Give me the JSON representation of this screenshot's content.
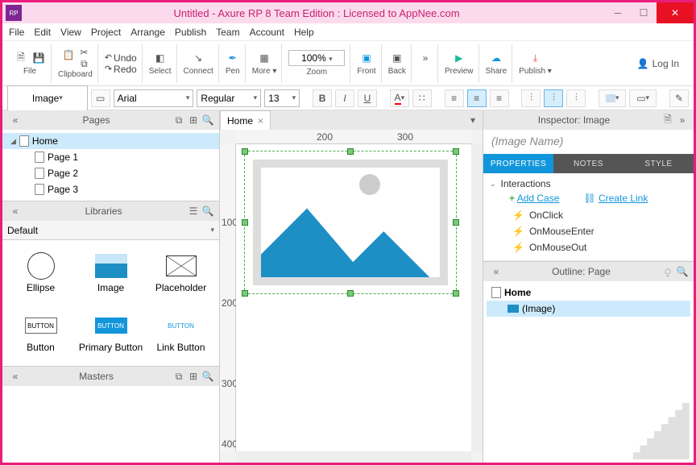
{
  "title": "Untitled - Axure RP 8 Team Edition : Licensed to AppNee.com",
  "menu": [
    "File",
    "Edit",
    "View",
    "Project",
    "Arrange",
    "Publish",
    "Team",
    "Account",
    "Help"
  ],
  "toolbar": {
    "file": "File",
    "clipboard": "Clipboard",
    "undo": "Undo",
    "redo": "Redo",
    "select": "Select",
    "connect": "Connect",
    "pen": "Pen",
    "more": "More ▾",
    "zoom_value": "100%",
    "zoom": "Zoom",
    "front": "Front",
    "back": "Back",
    "preview": "Preview",
    "share": "Share",
    "publish": "Publish ▾",
    "login": "Log In"
  },
  "format": {
    "shape": "Image",
    "font": "Arial",
    "style": "Regular",
    "size": "13"
  },
  "pages_panel": {
    "title": "Pages"
  },
  "pages": [
    "Home",
    "Page 1",
    "Page 2",
    "Page 3"
  ],
  "libraries_panel": {
    "title": "Libraries",
    "selected": "Default"
  },
  "widgets": [
    {
      "label": "Ellipse"
    },
    {
      "label": "Image"
    },
    {
      "label": "Placeholder"
    },
    {
      "label": "Button",
      "text": "BUTTON"
    },
    {
      "label": "Primary Button",
      "text": "BUTTON"
    },
    {
      "label": "Link Button",
      "text": "BUTTON"
    }
  ],
  "masters_panel": {
    "title": "Masters"
  },
  "canvas_tab": "Home",
  "ruler_h": [
    "200",
    "300"
  ],
  "ruler_v": [
    "100",
    "200",
    "300",
    "400"
  ],
  "inspector": {
    "title": "Inspector: Image",
    "name": "(Image Name)",
    "tabs": [
      "PROPERTIES",
      "NOTES",
      "STYLE"
    ],
    "interactions": "Interactions",
    "add_case": "Add Case",
    "create_link": "Create Link",
    "events": [
      "OnClick",
      "OnMouseEnter",
      "OnMouseOut"
    ]
  },
  "outline": {
    "title": "Outline: Page",
    "rows": [
      "Home",
      "(Image)"
    ]
  }
}
